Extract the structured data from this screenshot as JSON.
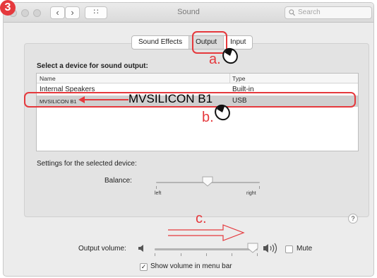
{
  "step_badge": "3",
  "window": {
    "title": "Sound",
    "search_placeholder": "Search",
    "nav_back": "‹",
    "nav_forward": "›",
    "grid_glyph": "∷"
  },
  "tabs": [
    {
      "label": "Sound Effects",
      "selected": false
    },
    {
      "label": "Output",
      "selected": true
    },
    {
      "label": "Input",
      "selected": false
    }
  ],
  "output": {
    "heading": "Select a device for sound output:",
    "columns": {
      "name": "Name",
      "type": "Type"
    },
    "devices": [
      {
        "name": "Internal Speakers",
        "type": "Built-in"
      },
      {
        "name": "MVSILICON B1",
        "type": "USB",
        "selected": true
      }
    ],
    "settings_label": "Settings for the selected device:",
    "balance": {
      "label": "Balance:",
      "left": "left",
      "right": "right",
      "value": 0.5
    }
  },
  "bottom": {
    "volume_label": "Output volume:",
    "volume_value": 0.9,
    "mute_label": "Mute",
    "mute_checked": false,
    "show_in_menubar_label": "Show volume in menu bar",
    "show_in_menubar_checked": true,
    "check_glyph": "✓"
  },
  "help_glyph": "?",
  "annotations": {
    "a": "a.",
    "b": "b.",
    "c": "c.",
    "device_callout": "MVSILICON B1",
    "color": "#e5393d"
  }
}
